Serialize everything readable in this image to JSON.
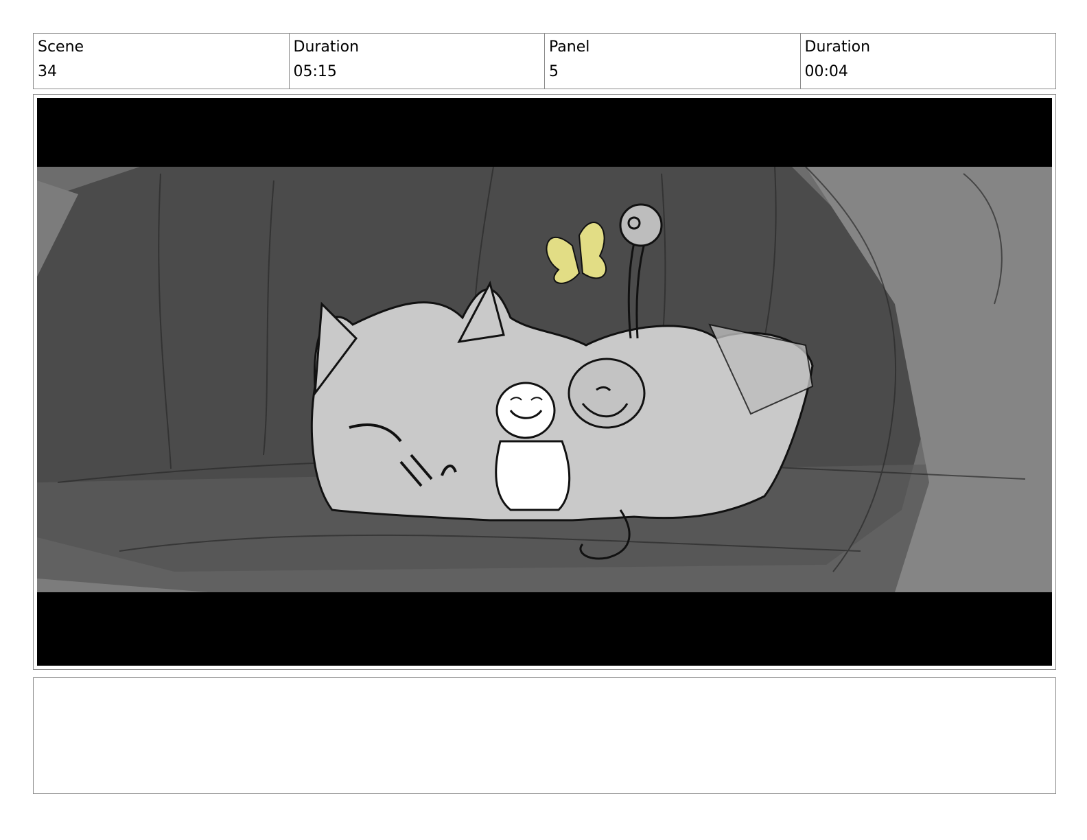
{
  "header": {
    "scene_label": "Scene",
    "scene_value": "34",
    "scene_duration_label": "Duration",
    "scene_duration_value": "05:15",
    "panel_label": "Panel",
    "panel_value": "5",
    "panel_duration_label": "Duration",
    "panel_duration_value": "00:04"
  },
  "notes": {
    "text": ""
  },
  "colors": {
    "letterbox": "#000000",
    "cave_dark": "#4a4a4a",
    "cave_mid": "#6b6b6b",
    "cave_light": "#8a8a8a",
    "creature": "#c8c8c8",
    "butterfly": "#e2dd85"
  }
}
